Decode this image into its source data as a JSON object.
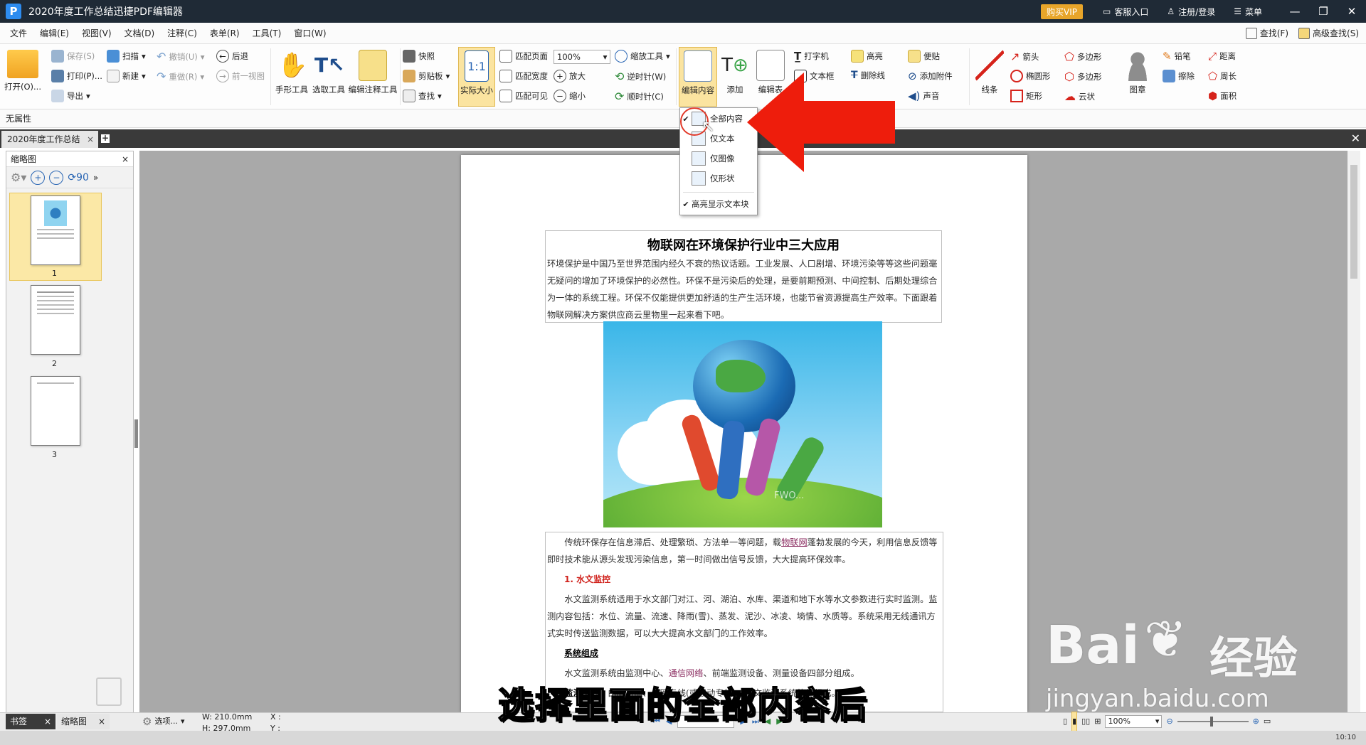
{
  "app": {
    "logo_letter": "P",
    "title": "2020年度工作总结迅捷PDF编辑器",
    "vip": "购买VIP",
    "service": "客服入口",
    "login": "注册/登录",
    "menu": "菜单"
  },
  "menu": {
    "items": [
      "文件",
      "编辑(E)",
      "视图(V)",
      "文档(D)",
      "注释(C)",
      "表单(R)",
      "工具(T)",
      "窗口(W)"
    ],
    "find": "查找(F)",
    "adv_find": "高级查找(S)"
  },
  "ribbon": {
    "open": "打开(O)...",
    "save": "保存(S)",
    "print": "打印(P)...",
    "export": "导出",
    "scan": "扫描",
    "new": "新建",
    "undo": "撤销(U)",
    "redo": "重做(R)",
    "back": "后退",
    "prev_view": "前一视图",
    "hand": "手形工具",
    "select": "选取工具",
    "edit_annot": "编辑注释工具",
    "snapshot": "快照",
    "clipboard": "剪贴板",
    "find": "查找",
    "actual_size": "实际大小",
    "fit_page": "匹配页面",
    "fit_width": "匹配宽度",
    "fit_visible": "匹配可见",
    "zoom_value": "100%",
    "zoom_tool": "缩放工具",
    "zoom_in": "放大",
    "zoom_out": "缩小",
    "ccw": "逆时针(W)",
    "cw": "顺时针(C)",
    "edit_content": "编辑内容",
    "add": "添加",
    "edit_form": "编辑表",
    "typewriter": "打字机",
    "textbox": "文本框",
    "highlight": "高亮",
    "strikeout": "删除线",
    "note": "便贴",
    "attach": "添加附件",
    "sound": "声音",
    "line": "线条",
    "arrow": "箭头",
    "ellipse": "椭圆形",
    "rect": "矩形",
    "polygon": "多边形",
    "polyline": "多边形",
    "cloud": "云状",
    "stamp": "图章",
    "pencil": "铅笔",
    "eraser": "擦除",
    "distance": "距离",
    "perimeter": "周长",
    "area": "面积"
  },
  "props": {
    "label": "无属性"
  },
  "tabs": {
    "doc": "2020年度工作总结"
  },
  "thumbs": {
    "title": "缩略图",
    "pages": [
      "1",
      "2",
      "3"
    ]
  },
  "dropdown": {
    "items": [
      "全部内容",
      "仅文本",
      "仅图像",
      "仅形状",
      "高亮显示文本块"
    ],
    "checked": [
      true,
      false,
      false,
      false,
      true
    ]
  },
  "doc": {
    "title": "物联网在环境保护行业中三大应用",
    "intro": "环境保护是中国乃至世界范围内经久不衰的热议话题。工业发展、人口剧增、环境污染等等这些问题毫无疑问的增加了环境保护的必然性。环保不是污染后的处理，是要前期预测、中间控制、后期处理综合为一体的系统工程。环保不仅能提供更加舒适的生产生活环境，也能节省资源提高生产效率。下面跟着物联网解决方案供应商云里物里一起来看下吧。",
    "p2_a": "传统环保存在信息滞后、处理繁琐、方法单一等问题，载",
    "p2_link": "物联网",
    "p2_b": "蓬勃发展的今天，利用信息反馈等即时技术能从源头发现污染信息，第一时间做出信号反馈，大大提高环保效率。",
    "h1": "1. 水文监控",
    "p3": "水文监测系统适用于水文部门对江、河、湖泊、水库、渠道和地下水等水文参数进行实时监测。监测内容包括：水位、流量、流速、降雨(雪)、蒸发、泥沙、冰凌、墒情、水质等。系统采用无线通讯方式实时传送监测数据，可以大大提高水文部门的工作效率。",
    "h2": "系统组成",
    "p4_a": "水文监测系统由监测中心、",
    "p4_link": "通信网络",
    "p4_b": "、前端监测设备、测量设备四部分组成。",
    "p5_label": "监测中心",
    "p5": "：由服务器、公网专线(或移动专线)、水文监测系统软件组成。",
    "image_watermark": "FWO..."
  },
  "status": {
    "bookmarks": "书签",
    "thumbs": "缩略图",
    "options": "选项...",
    "w": "W: 210.0mm",
    "h": "H: 297.0mm",
    "x": "X :",
    "y": "Y :",
    "zoom": "100%",
    "time": "10:10"
  },
  "subtitle": "选择里面的全部内容后",
  "watermark": {
    "brand": "Bai",
    "brand2": "经验",
    "url": "jingyan.baidu.com"
  }
}
